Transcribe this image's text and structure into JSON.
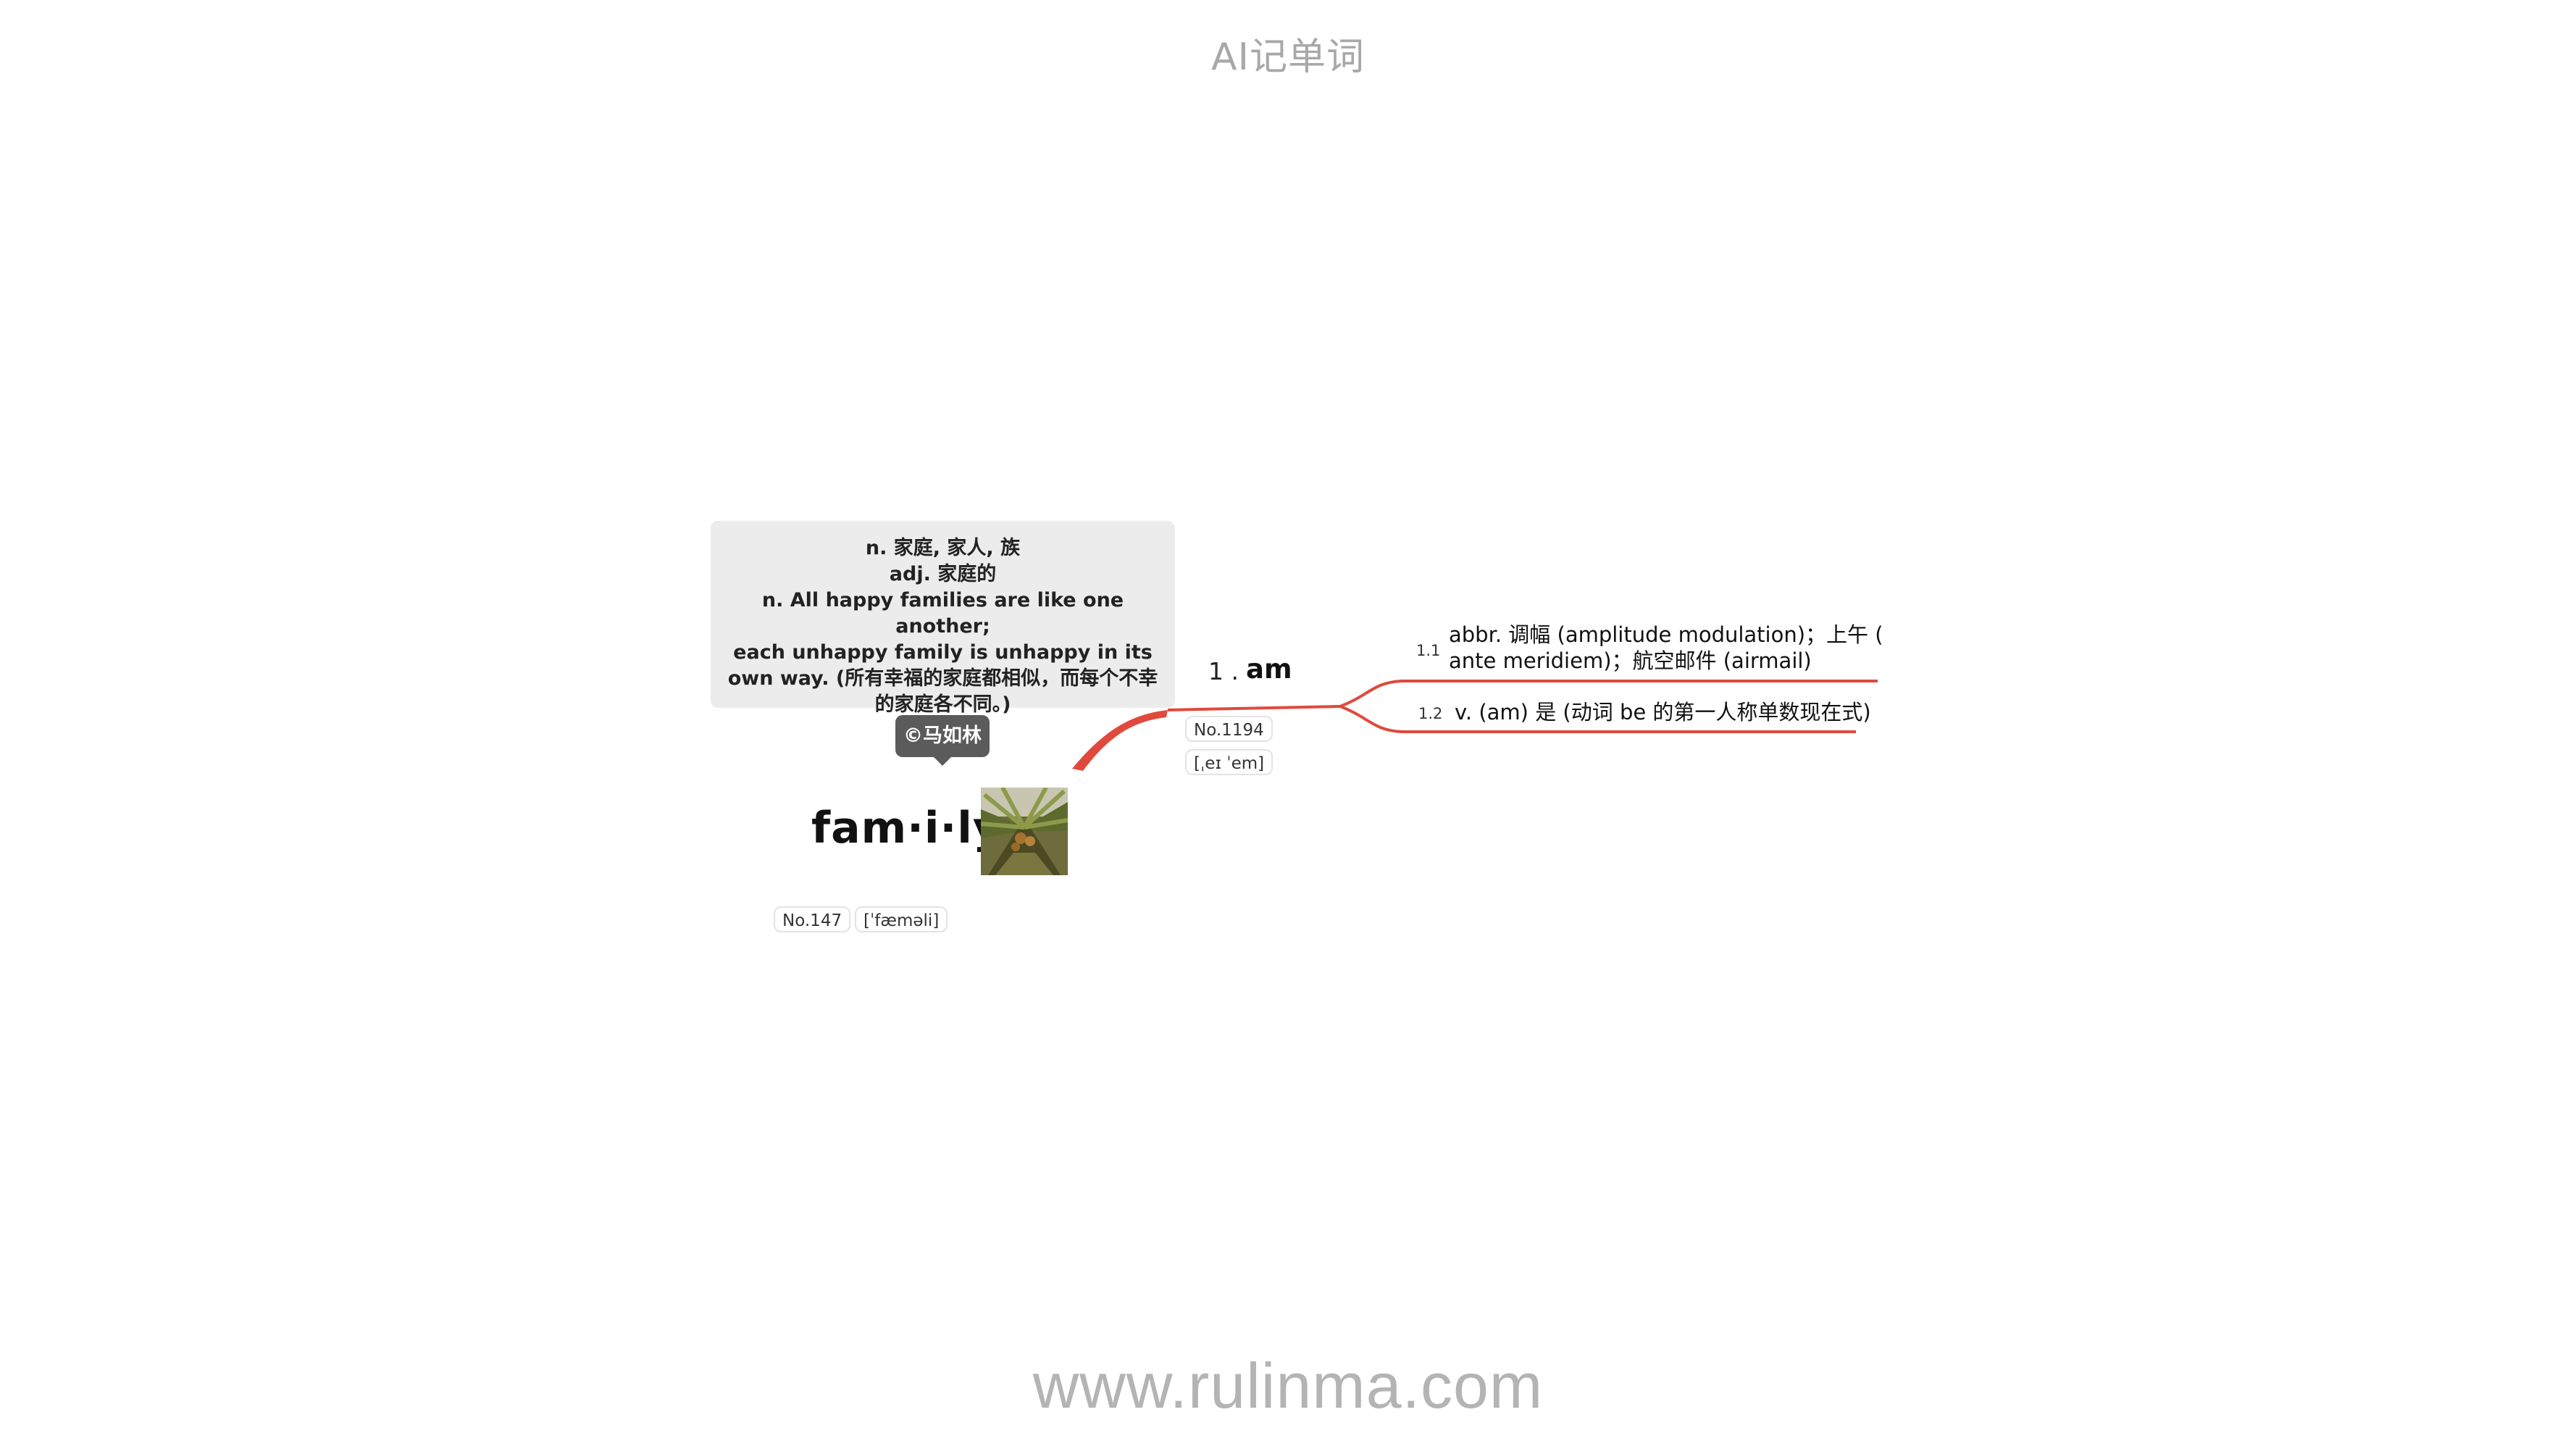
{
  "header": {
    "title": "AI记单词"
  },
  "footer": {
    "url": "www.rulinma.com"
  },
  "main_word": {
    "syllables": "fam·i·ly",
    "definition_lines": [
      "n. 家庭, 家人, 族",
      "adj. 家庭的",
      "n. All happy families are like one another;",
      "each unhappy family is unhappy in its",
      "own way. (所有幸福的家庭都相似，而每个不幸",
      "的家庭各不同。)"
    ],
    "author": "©马如林",
    "number": "No.147",
    "phonetic": "[ˈfæməli]",
    "image_icon": "palm-tree-photo"
  },
  "branch": {
    "index": "1 .",
    "word": "am",
    "number": "No.1194",
    "phonetic": "[ˌeɪ ˈem]",
    "sub_items": [
      {
        "index": "1.1",
        "line1": "abbr. 调幅 (amplitude modulation)；上午 (",
        "line2": "ante meridiem)；航空邮件 (airmail)"
      },
      {
        "index": "1.2",
        "line1": "v. (am) 是 (动词 be 的第一人称单数现在式)"
      }
    ]
  },
  "colors": {
    "connector": "#e04a3c",
    "tag_bg": "#5b5b5b",
    "definition_bg": "#ececec"
  }
}
